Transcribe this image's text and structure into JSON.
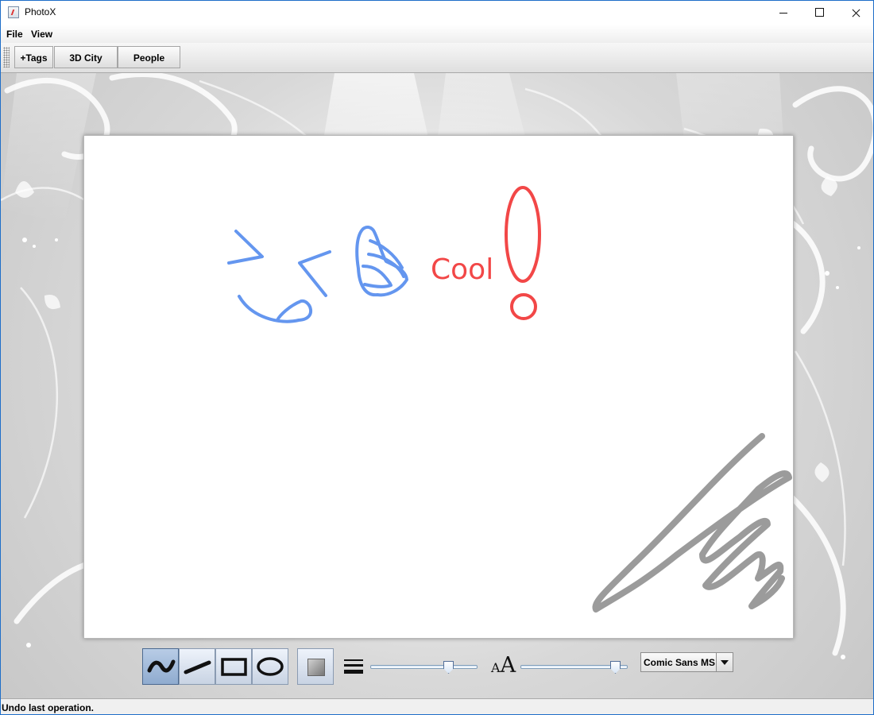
{
  "window": {
    "title": "PhotoX"
  },
  "menu": {
    "file": "File",
    "view": "View"
  },
  "toolbar": {
    "tags": "+Tags",
    "city": "3D City",
    "people": "People"
  },
  "annotation": {
    "text": "Cool"
  },
  "drawing_tools": {
    "selected_tool": "freehand"
  },
  "colors": {
    "blue_stroke": "#6496ef",
    "red_stroke": "#f24747",
    "gray_stroke": "#9b9b9b"
  },
  "settings": {
    "stroke_width_level": 0.76,
    "font_size_level": 0.93,
    "font_name": "Comic Sans MS"
  },
  "status": {
    "message": "Undo last operation."
  }
}
